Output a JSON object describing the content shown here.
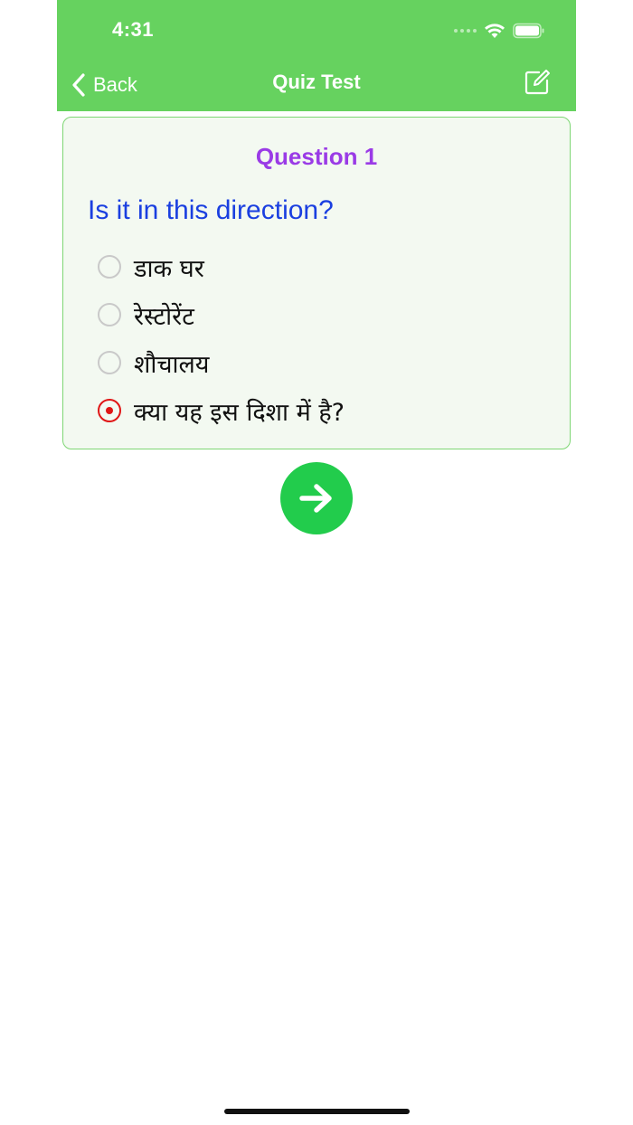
{
  "status_bar": {
    "time": "4:31"
  },
  "nav": {
    "back_label": "Back",
    "title": "Quiz Test"
  },
  "quiz": {
    "question_number": "Question 1",
    "question_text": "Is it in this direction?",
    "options": [
      {
        "label": "डाक घर",
        "selected": false
      },
      {
        "label": "रेस्टोरेंट",
        "selected": false
      },
      {
        "label": "शौचालय",
        "selected": false
      },
      {
        "label": "क्या यह इस दिशा में है?",
        "selected": true
      }
    ]
  },
  "colors": {
    "header_bg": "#66d25f",
    "question_number": "#9a3be6",
    "question_text": "#1a3fe0",
    "selected_radio": "#e01616",
    "next_button": "#22cc4c"
  },
  "icons": {
    "back": "chevron-left-icon",
    "edit": "compose-icon",
    "next": "arrow-right-icon",
    "wifi": "wifi-icon",
    "battery": "battery-icon"
  }
}
